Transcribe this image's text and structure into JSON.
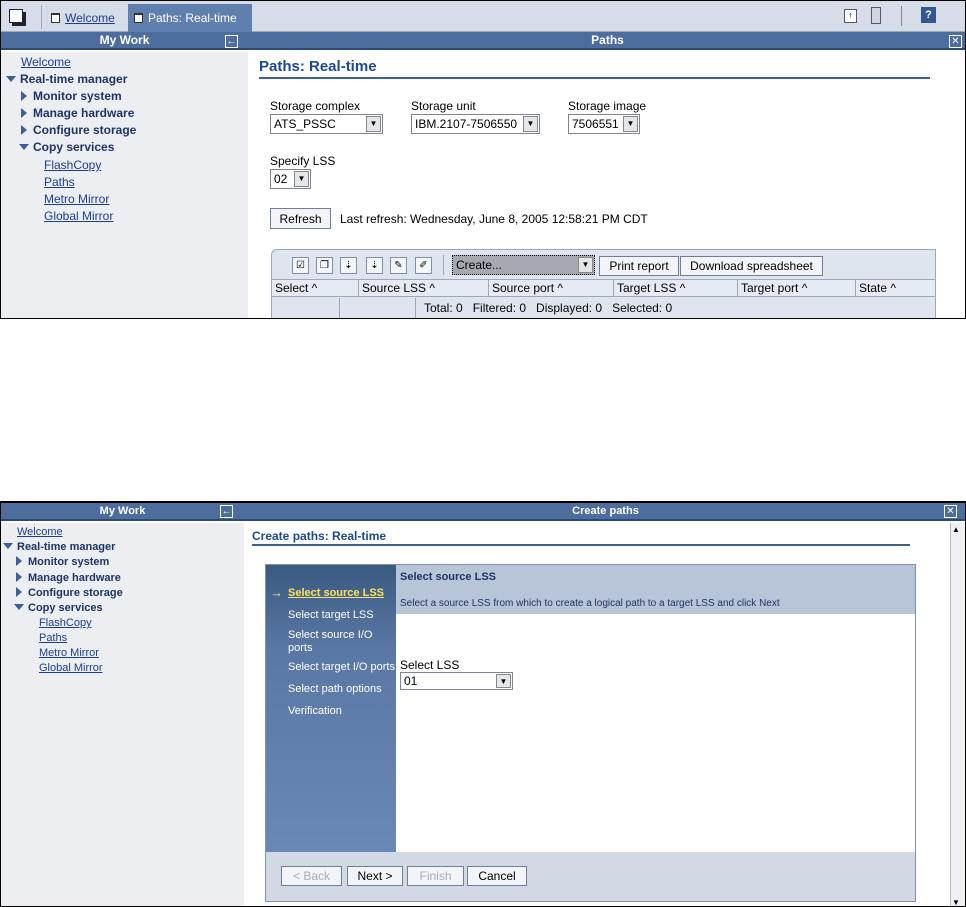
{
  "top": {
    "tabs": [
      {
        "label": "Welcome"
      },
      {
        "label": "Paths: Real-time"
      }
    ],
    "sidebar": {
      "title": "My Work",
      "items": [
        "Welcome",
        "Real-time manager",
        "Monitor system",
        "Manage hardware",
        "Configure storage",
        "Copy services",
        "FlashCopy",
        "Paths",
        "Metro Mirror",
        "Global Mirror"
      ]
    },
    "main_title": "Paths",
    "page_title": "Paths: Real-time",
    "storage_complex": {
      "label": "Storage complex",
      "value": "ATS_PSSC"
    },
    "storage_unit": {
      "label": "Storage unit",
      "value": "IBM.2107-7506550"
    },
    "storage_image": {
      "label": "Storage image",
      "value": "7506551"
    },
    "specify_lss": {
      "label": "Specify LSS",
      "value": "02"
    },
    "refresh_label": "Refresh",
    "last_refresh": "Last refresh: Wednesday, June 8, 2005 12:58:21 PM CDT",
    "action_select": "Create...",
    "print_report": "Print report",
    "download": "Download spreadsheet",
    "columns": [
      "Select ^",
      "Source LSS ^",
      "Source port ^",
      "Target LSS ^",
      "Target port ^",
      "State ^"
    ],
    "summary": "Total: 0   Filtered: 0   Displayed: 0   Selected: 0",
    "help": "?"
  },
  "bottom": {
    "sidebar": {
      "title": "My Work",
      "items": [
        "Welcome",
        "Real-time manager",
        "Monitor system",
        "Manage hardware",
        "Configure storage",
        "Copy services",
        "FlashCopy",
        "Paths",
        "Metro Mirror",
        "Global Mirror"
      ]
    },
    "main_title": "Create paths",
    "page_title": "Create paths: Real-time",
    "steps": [
      "Select source LSS",
      "Select target LSS",
      "Select source I/O ports",
      "Select target I/O ports",
      "Select path options",
      "Verification"
    ],
    "current_step": "Select source LSS",
    "step_title": "Select source LSS",
    "step_desc": "Select a source LSS from which to create a logical path to a target LSS and click Next",
    "lss_label": "Select LSS",
    "lss_value": "01",
    "back": "< Back",
    "next": "Next >",
    "finish": "Finish",
    "cancel": "Cancel"
  },
  "colors": {
    "title_bar": "#4d6d9f",
    "accent": "#1c4a8c",
    "wizard_nav": "#5a78a6",
    "current_step": "#ffe060"
  }
}
